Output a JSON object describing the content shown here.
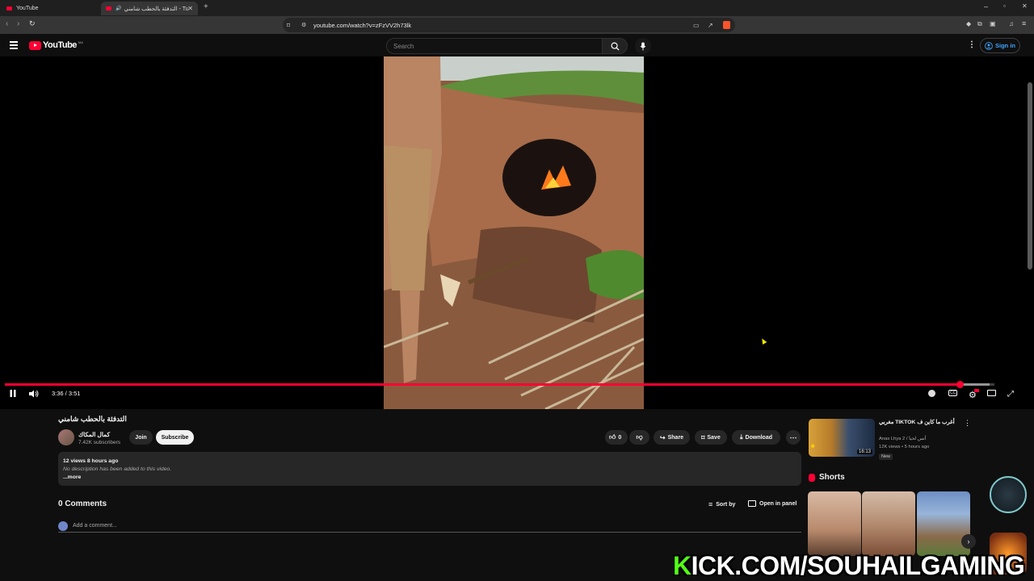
{
  "browser": {
    "tabs": [
      {
        "label": "YouTube"
      },
      {
        "label": "التدفئة بالحطب شامني - Tube"
      }
    ],
    "url": "youtube.com/watch?v=zFzVV2h73lk"
  },
  "header": {
    "logo_text": "YouTube",
    "logo_country": "MA",
    "search_placeholder": "Search",
    "signin_label": "Sign in"
  },
  "player": {
    "time_display": "3:36 / 3:51",
    "progress": 0.965,
    "buffered": 0.995
  },
  "video": {
    "title": "التدفئة بالحطب شامني",
    "channel_name": "كمال المكاك",
    "subscribers": "7.42K subscribers",
    "join_label": "Join",
    "subscribe_label": "Subscribe",
    "like_count": "0",
    "share_label": "Share",
    "save_label": "Save",
    "download_label": "Download",
    "views_line": "12 views  8 hours ago",
    "description": "No description has been added to this video.",
    "more_label": "...more"
  },
  "comments": {
    "heading": "0 Comments",
    "sort_label": "Sort by",
    "panel_label": "Open in panel",
    "add_placeholder": "Add a comment..."
  },
  "sidebar": {
    "recommended": {
      "title": "أغرب ما كاين ف TIKTOK مغربي",
      "channel": "Anas Lhya 2 / أنس لحيا",
      "meta": "12K views • 5 hours ago",
      "badge": "New",
      "duration": "16:13"
    },
    "shorts_heading": "Shorts"
  },
  "overlay": {
    "kick_k": "K",
    "kick_rest": "ICK.COM/SOUHAILGAMING"
  }
}
